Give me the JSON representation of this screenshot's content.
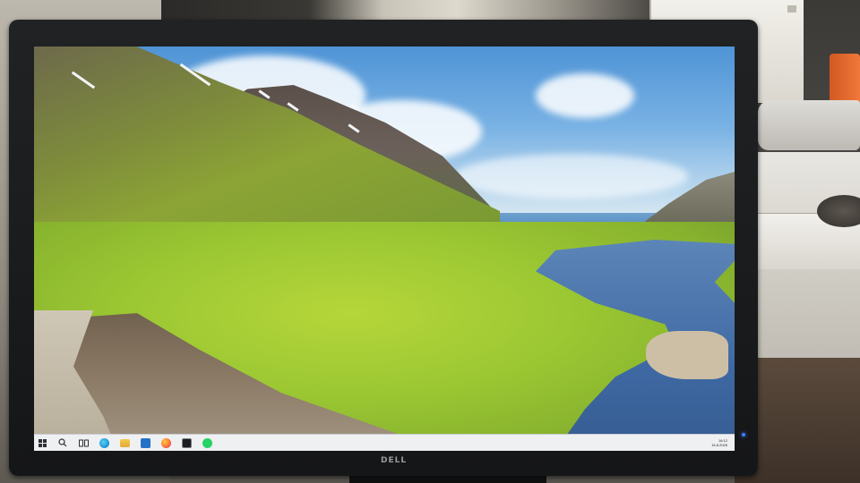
{
  "monitor": {
    "brand": "DELL"
  },
  "taskbar": {
    "start_button": "Start",
    "pinned": [
      {
        "icon": "search-icon",
        "label": ""
      },
      {
        "icon": "task-view-icon",
        "label": ""
      },
      {
        "icon": "edge-icon",
        "label": ""
      },
      {
        "icon": "file-explorer-icon",
        "label": ""
      },
      {
        "icon": "store-icon",
        "label": ""
      },
      {
        "icon": "firefox-icon",
        "label": ""
      },
      {
        "icon": "media-player-icon",
        "label": ""
      },
      {
        "icon": "whatsapp-icon",
        "label": ""
      }
    ],
    "clock": {
      "time": "16:12",
      "date": "15.8.2026"
    }
  },
  "colors": {
    "led": "#3c7cff",
    "taskbar": "#eef0f2",
    "edge": "#1b8fd4",
    "whatsapp": "#25d366",
    "firefox": "#ff7139"
  }
}
